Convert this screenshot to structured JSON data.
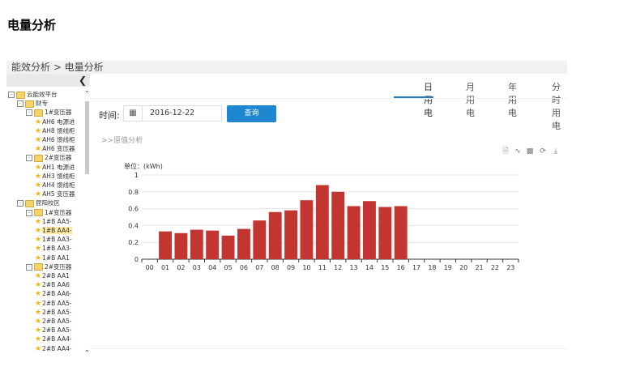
{
  "page_title": "电量分析",
  "breadcrumb": "能效分析 > 电量分析",
  "sidebar": {
    "collapse_icon": "chevron-left-icon",
    "tree": [
      {
        "label": "云能效平台",
        "level": 0,
        "type": "folder"
      },
      {
        "label": "财专",
        "level": 1,
        "type": "folder"
      },
      {
        "label": "1#变压器",
        "level": 2,
        "type": "folder"
      },
      {
        "label": "AH6 电源进",
        "level": 3,
        "type": "leaf"
      },
      {
        "label": "AH8 馈线柜",
        "level": 3,
        "type": "leaf"
      },
      {
        "label": "AH6 馈线柜",
        "level": 3,
        "type": "leaf"
      },
      {
        "label": "AH6 变压器",
        "level": 3,
        "type": "leaf"
      },
      {
        "label": "2#变压器",
        "level": 2,
        "type": "folder"
      },
      {
        "label": "AH1 电源进",
        "level": 3,
        "type": "leaf"
      },
      {
        "label": "AH3 馈线柜",
        "level": 3,
        "type": "leaf"
      },
      {
        "label": "AH4 馈线柜",
        "level": 3,
        "type": "leaf"
      },
      {
        "label": "AH5 变压器",
        "level": 3,
        "type": "leaf"
      },
      {
        "label": "昆阳校区",
        "level": 1,
        "type": "folder"
      },
      {
        "label": "1#变压器",
        "level": 2,
        "type": "folder"
      },
      {
        "label": "1#B AA5-",
        "level": 3,
        "type": "leaf"
      },
      {
        "label": "1#B AA4-",
        "level": 3,
        "type": "leaf",
        "selected": true
      },
      {
        "label": "1#B AA3-",
        "level": 3,
        "type": "leaf"
      },
      {
        "label": "1#B AA3-",
        "level": 3,
        "type": "leaf"
      },
      {
        "label": "1#B AA1",
        "level": 3,
        "type": "leaf"
      },
      {
        "label": "2#变压器",
        "level": 2,
        "type": "folder"
      },
      {
        "label": "2#B AA1",
        "level": 3,
        "type": "leaf"
      },
      {
        "label": "2#B AA6",
        "level": 3,
        "type": "leaf"
      },
      {
        "label": "2#B AA6-",
        "level": 3,
        "type": "leaf"
      },
      {
        "label": "2#B AA5-",
        "level": 3,
        "type": "leaf"
      },
      {
        "label": "2#B AA5-",
        "level": 3,
        "type": "leaf"
      },
      {
        "label": "2#B AA5-",
        "level": 3,
        "type": "leaf"
      },
      {
        "label": "2#B AA5-",
        "level": 3,
        "type": "leaf"
      },
      {
        "label": "2#B AA4-",
        "level": 3,
        "type": "leaf"
      },
      {
        "label": "2#B AA4-",
        "level": 3,
        "type": "leaf"
      }
    ]
  },
  "tabs": [
    {
      "label": "日用电",
      "active": true
    },
    {
      "label": "月用电",
      "active": false
    },
    {
      "label": "年用电",
      "active": false
    },
    {
      "label": "分时用电",
      "active": false
    }
  ],
  "filter": {
    "time_label": "时间:",
    "calendar_icon": "calendar-icon",
    "date_value": "2016-12-22",
    "query_label": "查询"
  },
  "sub_link": ">>原值分析",
  "toolbar_icons": [
    "document-icon",
    "line-chart-icon",
    "bar-chart-icon",
    "refresh-icon",
    "download-icon"
  ],
  "chart_data": {
    "type": "bar",
    "unit_label": "单位：(kWh)",
    "categories": [
      "00",
      "01",
      "02",
      "03",
      "04",
      "05",
      "06",
      "07",
      "08",
      "09",
      "10",
      "11",
      "12",
      "13",
      "14",
      "15",
      "16",
      "17",
      "18",
      "19",
      "20",
      "21",
      "22",
      "23"
    ],
    "values": [
      null,
      0.33,
      0.31,
      0.35,
      0.34,
      0.28,
      0.36,
      0.46,
      0.56,
      0.58,
      0.7,
      0.88,
      0.8,
      0.63,
      0.69,
      0.62,
      0.63,
      null,
      null,
      null,
      null,
      null,
      null,
      null
    ],
    "ylim": [
      0,
      1
    ],
    "yticks": [
      "0",
      "0.2",
      "0.4",
      "0.6",
      "0.8",
      "1"
    ],
    "bar_color": "#c23531",
    "grid": true
  }
}
